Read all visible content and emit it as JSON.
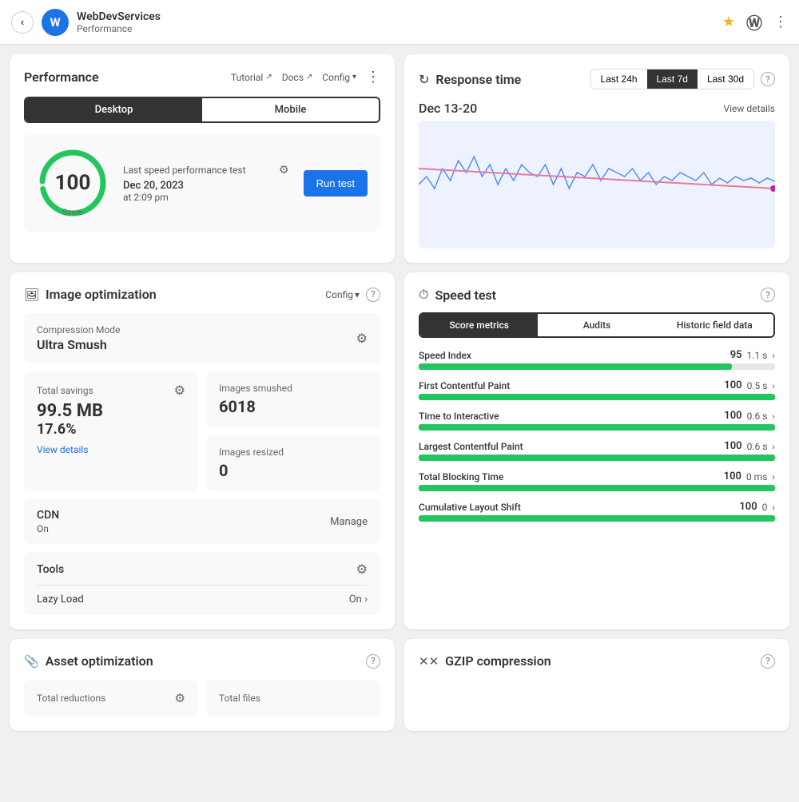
{
  "topbar": {
    "back_btn": "‹",
    "avatar_letter": "W",
    "site_name": "WebDevServices",
    "site_sub": "Performance",
    "star_icon": "★",
    "wp_icon": "ⓦ",
    "more_icon": "⋮"
  },
  "performance_card": {
    "title": "Performance",
    "tutorial_label": "Tutorial",
    "docs_label": "Docs",
    "config_label": "Config",
    "more_icon": "⋮",
    "tabs": [
      {
        "label": "Desktop",
        "active": true
      },
      {
        "label": "Mobile",
        "active": false
      }
    ],
    "score": "100",
    "score_label": "Score",
    "speed_test_title": "Last speed performance test",
    "test_date": "Dec 20, 2023",
    "test_time": "at 2:09 pm",
    "run_test_btn": "Run test"
  },
  "image_optimization": {
    "title": "Image optimization",
    "config_label": "Config",
    "help_label": "?",
    "compression_label": "Compression Mode",
    "compression_value": "Ultra Smush",
    "total_savings_label": "Total savings",
    "total_savings_mb": "99.5 MB",
    "total_savings_pct": "17.6%",
    "view_details_label": "View details",
    "images_smushed_label": "Images smushed",
    "images_smushed_value": "6018",
    "images_resized_label": "Images resized",
    "images_resized_value": "0",
    "cdn_title": "CDN",
    "cdn_status": "On",
    "manage_label": "Manage",
    "tools_title": "Tools",
    "lazy_load_label": "Lazy Load",
    "lazy_load_value": "On ›"
  },
  "response_time": {
    "title": "Response time",
    "help_label": "?",
    "time_buttons": [
      {
        "label": "Last 24h",
        "active": false
      },
      {
        "label": "Last 7d",
        "active": true
      },
      {
        "label": "Last 30d",
        "active": false
      }
    ],
    "date_range": "Dec 13-20",
    "view_details": "View details"
  },
  "speed_test": {
    "title": "Speed test",
    "help_label": "?",
    "tabs": [
      {
        "label": "Score metrics",
        "active": true
      },
      {
        "label": "Audits",
        "active": false
      },
      {
        "label": "Historic field data",
        "active": false
      }
    ],
    "metrics": [
      {
        "name": "Speed Index",
        "score": "95",
        "time": "1.1 s"
      },
      {
        "name": "First Contentful Paint",
        "score": "100",
        "time": "0.5 s"
      },
      {
        "name": "Time to Interactive",
        "score": "100",
        "time": "0.6 s"
      },
      {
        "name": "Largest Contentful Paint",
        "score": "100",
        "time": "0.6 s"
      },
      {
        "name": "Total Blocking Time",
        "score": "100",
        "time": "0 ms"
      },
      {
        "name": "Cumulative Layout Shift",
        "score": "100",
        "time": "0"
      }
    ],
    "bar_widths": [
      "88",
      "100",
      "100",
      "100",
      "100",
      "100"
    ]
  },
  "asset_optimization": {
    "title": "Asset optimization",
    "help_label": "?",
    "total_reductions_label": "Total reductions",
    "total_files_label": "Total files"
  },
  "gzip": {
    "title": "GZIP compression",
    "help_label": "?"
  }
}
